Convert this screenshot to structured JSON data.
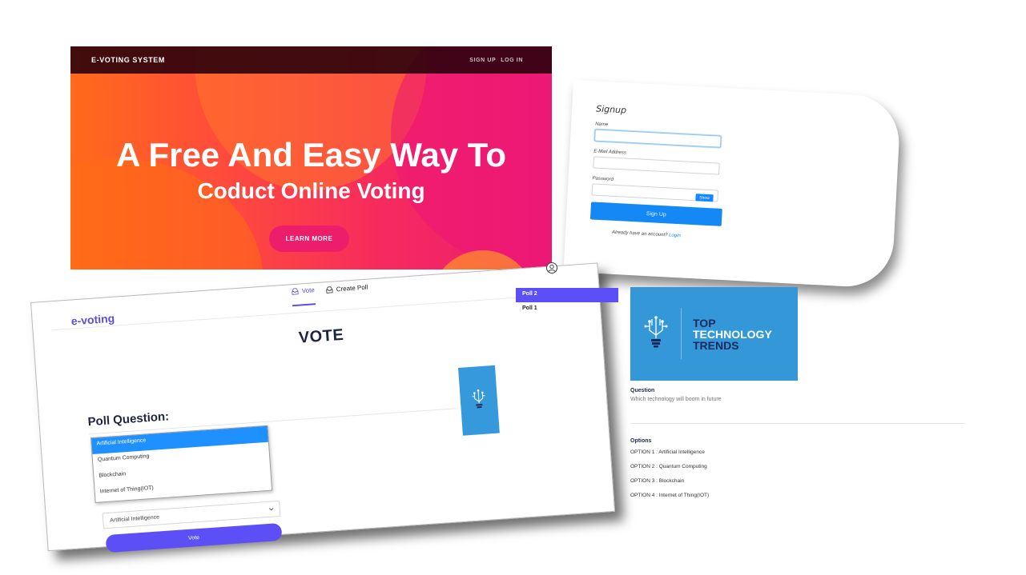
{
  "hero": {
    "brand": "E-VOTING SYSTEM",
    "nav": [
      "SIGN UP",
      "LOG IN"
    ],
    "headline": "A Free And Easy Way To",
    "subheadline": "Coduct Online Voting",
    "cta": "LEARN MORE",
    "colors": {
      "start": "#ff6a1a",
      "end": "#ec1d74",
      "button": "#ec1d6a"
    }
  },
  "signup": {
    "title": "Signup",
    "name_label": "Name",
    "email_label": "E-Mail Address",
    "password_label": "Password",
    "show_label": "Show",
    "submit_label": "Sign Up",
    "already_text": "Already have an account?",
    "login_link": "Login",
    "accent": "#1488f5"
  },
  "vote_app": {
    "logo": "e-voting",
    "nav": [
      {
        "label": "Vote",
        "icon": "tray-icon",
        "active": true
      },
      {
        "label": "Create Poll",
        "icon": "tray-icon",
        "active": false
      }
    ],
    "heading": "VOTE",
    "poll_question_label": "Poll Question:",
    "dropdown_options": [
      "Artificial Intelligence",
      "Quantum Computing",
      "Blockchain",
      "Internet of Thing(IOT)"
    ],
    "selected_value": "Artificial Intelligence",
    "vote_button": "Vote",
    "accent": "#5c4ff6"
  },
  "poll_list": [
    "Poll 2",
    "Poll 1"
  ],
  "banner": {
    "line1": "TOP",
    "line2": "TECHNOLOGY",
    "line3": "TRENDS",
    "icon": "lightbulb-circuit-icon",
    "color": "#3498d8"
  },
  "detail": {
    "question_label": "Question",
    "question_text": "Which technology will boom in future",
    "options_label": "Options",
    "options": [
      "OPTION 1 : Artificial Intelligence",
      "OPTION 2 : Quantum Computing",
      "OPTION 3 : Blockchain",
      "OPTION 4 : Internet of Thing(IOT)"
    ]
  }
}
